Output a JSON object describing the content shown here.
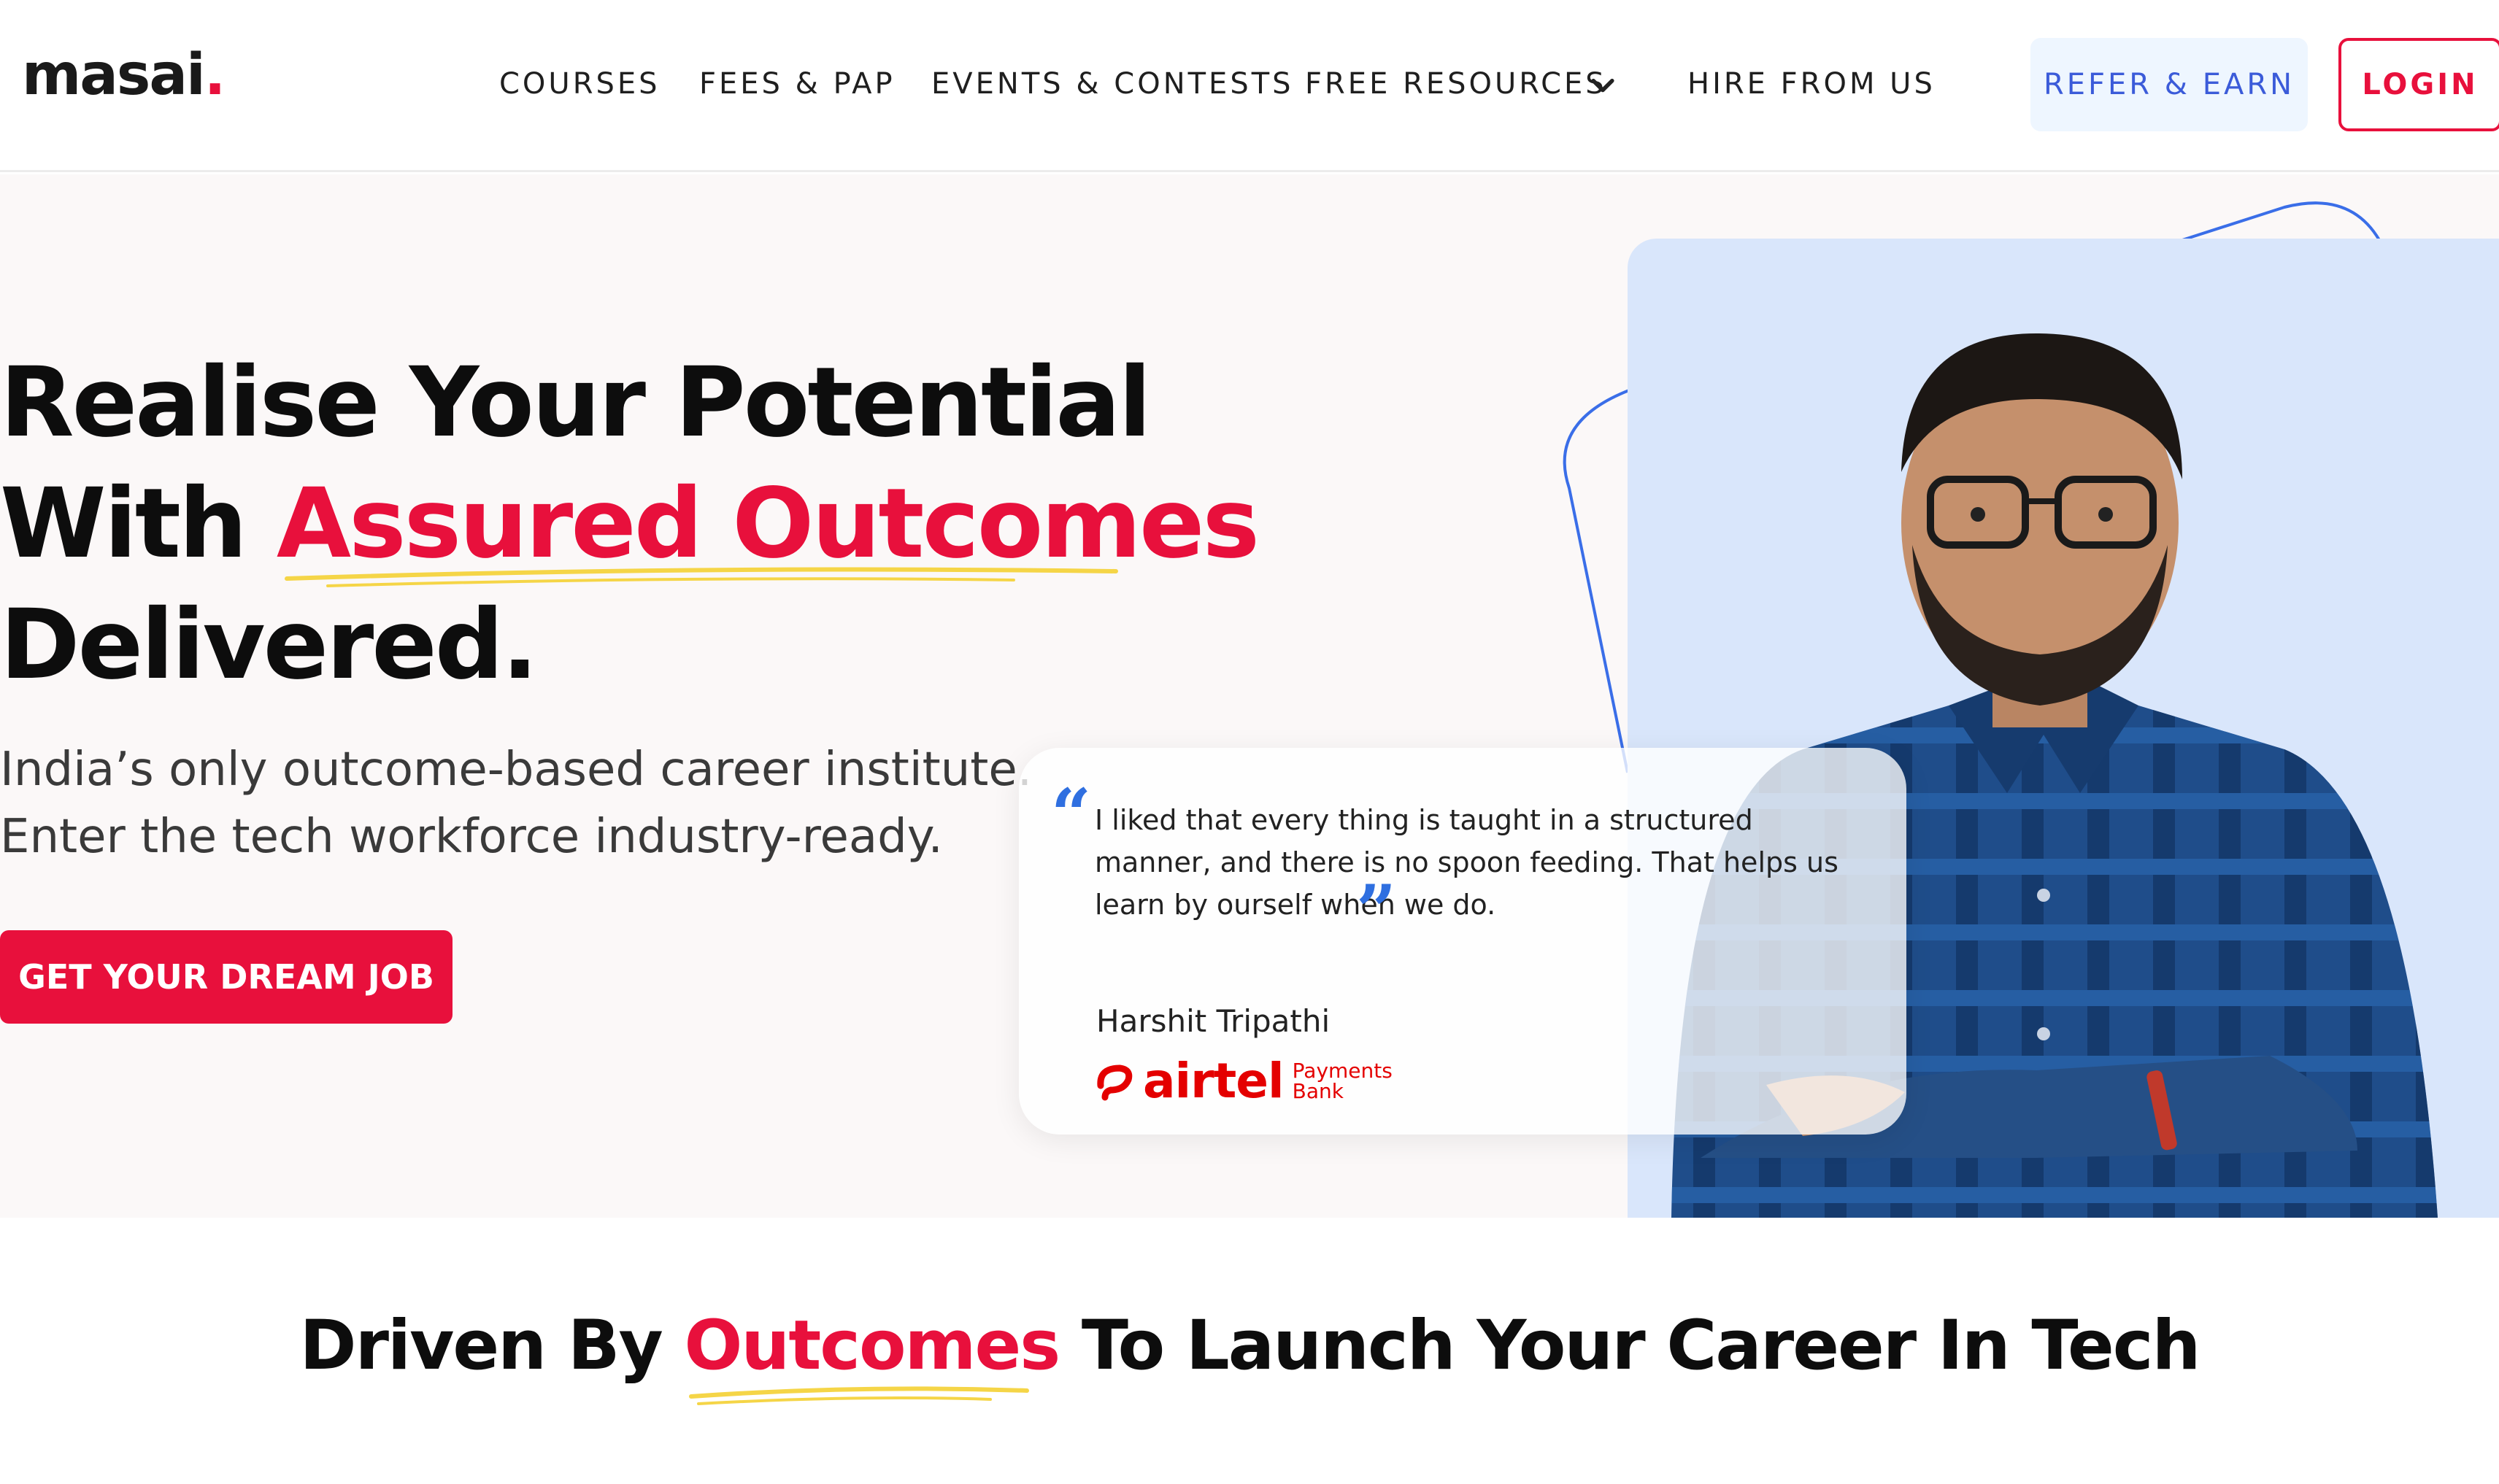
{
  "nav": {
    "logo": "masai",
    "logo_dot": ".",
    "links": [
      "COURSES",
      "FEES & PAP",
      "EVENTS & CONTESTS",
      "FREE RESOURCES",
      "HIRE FROM US"
    ],
    "refer_label": "REFER & EARN",
    "login_label": "LOGIN"
  },
  "hero": {
    "headline_line1": "Realise Your Potential",
    "headline_with": "With ",
    "headline_accent": "Assured Outcomes",
    "headline_line3": "Delivered.",
    "subtext_line1": "India’s only outcome-based career institute.",
    "subtext_line2": "Enter the tech workforce industry-ready.",
    "cta_label": "GET YOUR DREAM JOB"
  },
  "testimonial": {
    "open_quote": "“",
    "close_quote": "”",
    "quote": "I liked that every thing is taught in a structured manner, and there is no spoon feeding. That helps us learn by ourself when we do.",
    "author": "Harshit Tripathi",
    "company": "airtel",
    "company_sub_1": "Payments",
    "company_sub_2": "Bank"
  },
  "section": {
    "title_pre": "Driven By ",
    "title_accent": "Outcomes",
    "title_post": " To Launch Your Career In Tech"
  },
  "colors": {
    "brand_red": "#e8103c",
    "accent_blue": "#3b5bd9",
    "underline_yellow": "#f5d547",
    "photo_bg": "#d9e6fb"
  }
}
